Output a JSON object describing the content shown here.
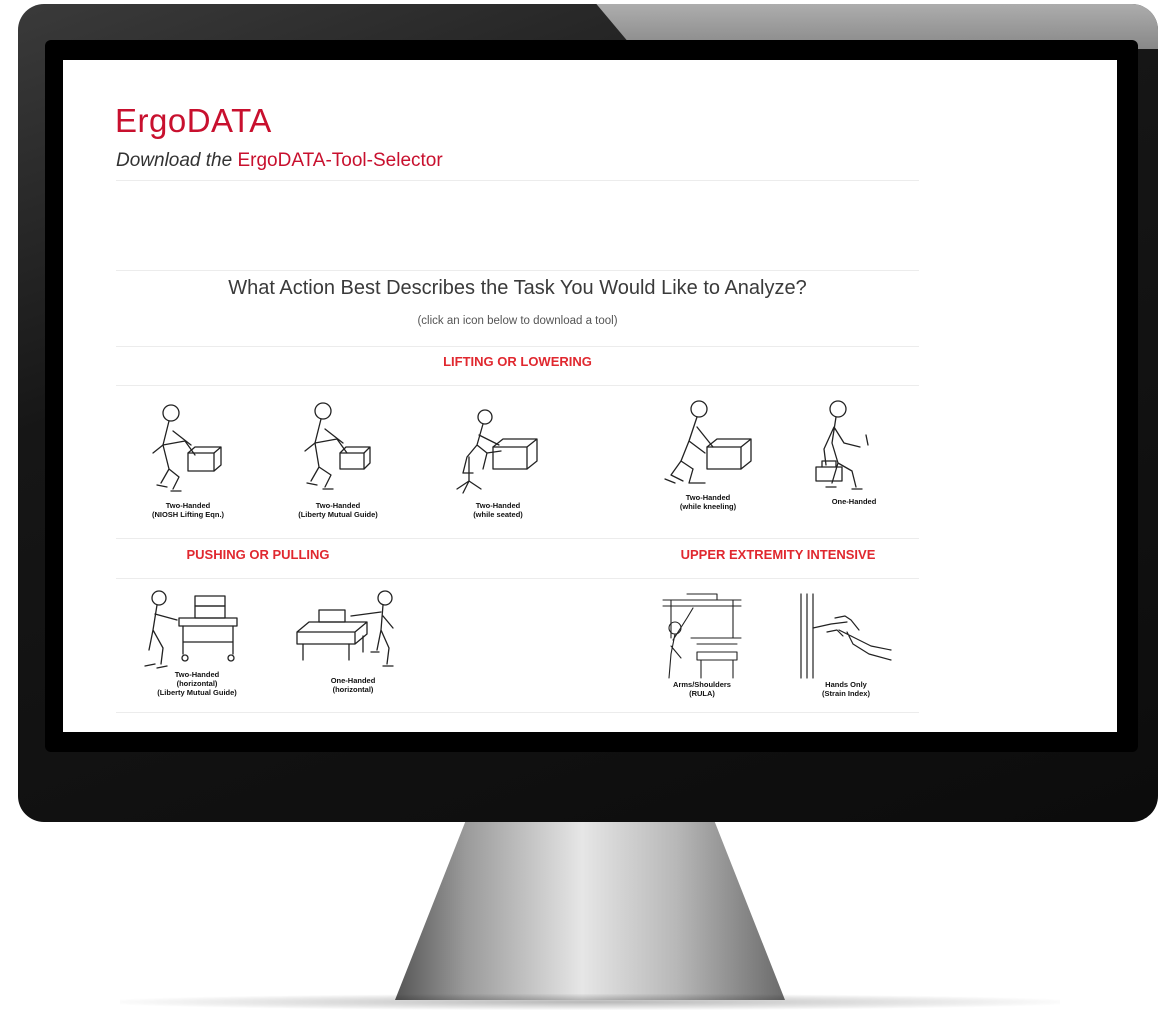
{
  "site": {
    "brand": "ErgoDATA",
    "download_prefix": "Download the",
    "download_link": "ErgoDATA-Tool-Selector"
  },
  "prompt": {
    "question": "What Action Best Describes the Task You Would Like to Analyze?",
    "hint": "(click an icon below to download a tool)"
  },
  "sections": {
    "lifting": "LIFTING OR LOWERING",
    "pushing": "PUSHING OR PULLING",
    "upper": "UPPER EXTREMITY INTENSIVE"
  },
  "tools": {
    "lift_niosh": {
      "line1": "Two-Handed",
      "line2": "(NIOSH Lifting Eqn.)",
      "icon": "worker-lifting-box-icon"
    },
    "lift_liberty": {
      "line1": "Two-Handed",
      "line2": "(Liberty Mutual Guide)",
      "icon": "worker-lifting-box-icon"
    },
    "lift_seated": {
      "line1": "Two-Handed",
      "line2": "(while seated)",
      "icon": "seated-worker-lifting-icon"
    },
    "lift_kneeling": {
      "line1": "Two-Handed",
      "line2": "(while kneeling)",
      "icon": "kneeling-worker-lifting-icon"
    },
    "lift_onehand": {
      "line1": "One-Handed",
      "icon": "worker-carrying-toolbox-icon"
    },
    "push_twohand": {
      "line1": "Two-Handed",
      "line2": "(horizontal)",
      "line3": "(Liberty Mutual Guide)",
      "icon": "worker-pushing-cart-icon"
    },
    "push_onehand": {
      "line1": "One-Handed",
      "line2": "(horizontal)",
      "icon": "worker-pushing-box-on-table-icon"
    },
    "arms_rula": {
      "line1": "Arms/Shoulders",
      "line2": "(RULA)",
      "icon": "worker-overhead-reach-icon"
    },
    "hands_strain": {
      "line1": "Hands Only",
      "line2": "(Strain Index)",
      "icon": "hand-using-tool-icon"
    }
  },
  "colors": {
    "brand_red": "#c8102e",
    "section_red": "#e0282f"
  }
}
